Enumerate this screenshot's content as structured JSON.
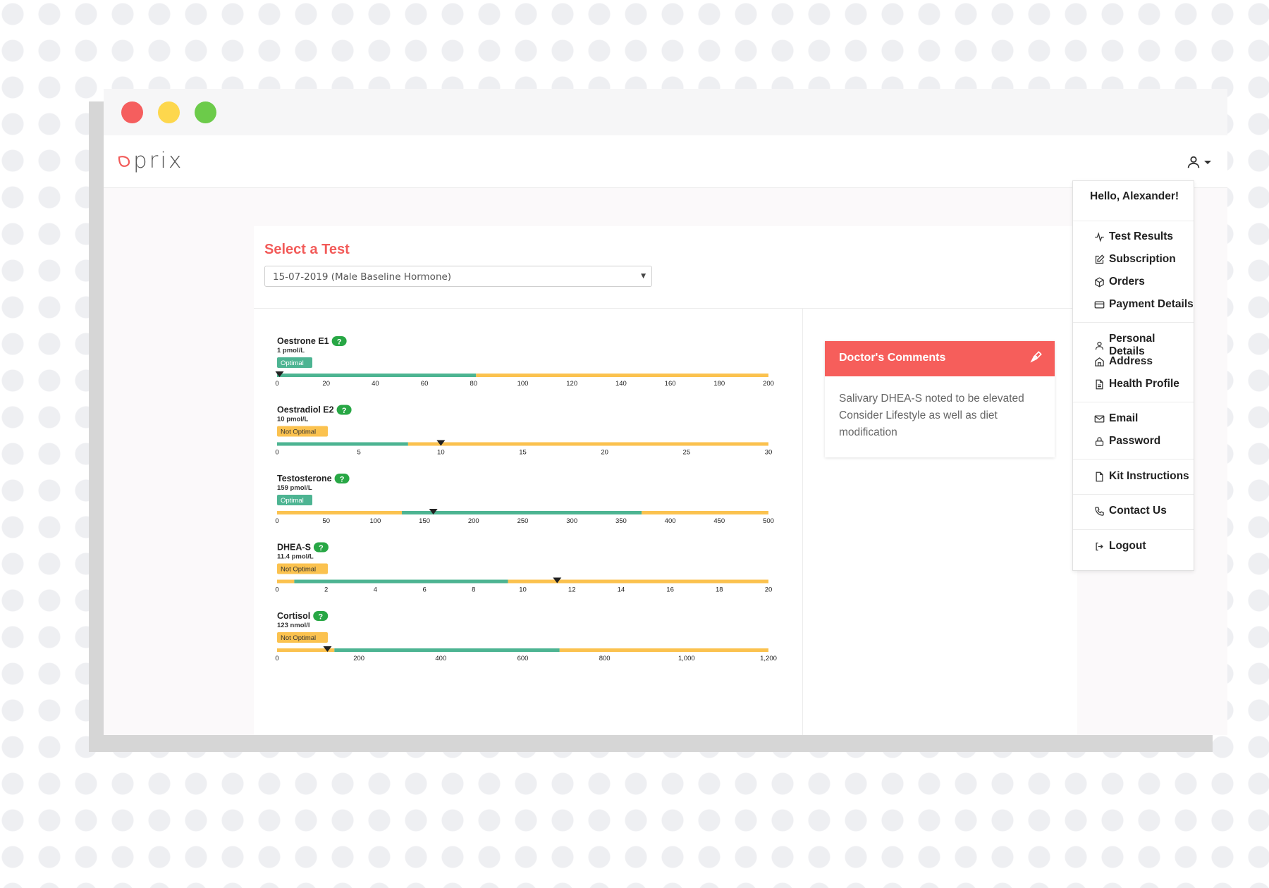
{
  "window": {
    "controls": [
      {
        "name": "close",
        "color": "#f55e5e"
      },
      {
        "name": "minimize",
        "color": "#fdd74d"
      },
      {
        "name": "maximize",
        "color": "#6ccb4a"
      }
    ]
  },
  "header": {
    "logo_text": "prix",
    "user_icon": "user-icon"
  },
  "select_test": {
    "title": "Select a Test",
    "selected": "15-07-2019 (Male Baseline Hormone)"
  },
  "doctor": {
    "title": "Doctor's Comments",
    "icon": "pen-icon",
    "lines": [
      "Salivary DHEA-S noted to be elevated",
      "Consider Lifestyle as well as diet",
      "modification"
    ]
  },
  "user_menu": {
    "greeting": "Hello, Alexander!",
    "items": [
      {
        "label": "Test Results",
        "icon": "activity-icon"
      },
      {
        "label": "Subscription",
        "icon": "edit-icon"
      },
      {
        "label": "Orders",
        "icon": "box-icon"
      },
      {
        "label": "Payment Details",
        "icon": "credit-card-icon"
      },
      {
        "label": "Personal Details",
        "icon": "user-icon"
      },
      {
        "label": "Address",
        "icon": "home-icon"
      },
      {
        "label": "Health Profile",
        "icon": "file-text-icon"
      },
      {
        "label": "Email",
        "icon": "mail-icon"
      },
      {
        "label": "Password",
        "icon": "lock-icon"
      },
      {
        "label": "Kit Instructions",
        "icon": "file-icon"
      },
      {
        "label": "Contact Us",
        "icon": "phone-icon"
      },
      {
        "label": "Logout",
        "icon": "log-out-icon"
      }
    ]
  },
  "colors": {
    "optimal": "#4db492",
    "not_optimal": "#fbc24f",
    "accent": "#f25b59",
    "help": "#28a745"
  },
  "chart_data": [
    {
      "type": "range-bar",
      "name": "Oestrone E1",
      "value_label": "1 pmol/L",
      "status": "Optimal",
      "value": 1,
      "xlim": [
        0,
        200
      ],
      "ticks": [
        0,
        20,
        40,
        60,
        80,
        100,
        120,
        140,
        160,
        180,
        200
      ],
      "tick_labels": [
        "0",
        "20",
        "40",
        "60",
        "80",
        "100",
        "120",
        "140",
        "160",
        "180",
        "200"
      ],
      "segments": [
        {
          "from": 0,
          "to": 81,
          "status": "optimal"
        },
        {
          "from": 81,
          "to": 200,
          "status": "not_optimal"
        }
      ]
    },
    {
      "type": "range-bar",
      "name": "Oestradiol E2",
      "value_label": "10 pmol/L",
      "status": "Not Optimal",
      "value": 10,
      "xlim": [
        0,
        30
      ],
      "ticks": [
        0,
        5,
        10,
        15,
        20,
        25,
        30
      ],
      "tick_labels": [
        "0",
        "5",
        "10",
        "15",
        "20",
        "25",
        "30"
      ],
      "segments": [
        {
          "from": 0,
          "to": 8,
          "status": "optimal"
        },
        {
          "from": 8,
          "to": 30,
          "status": "not_optimal"
        }
      ]
    },
    {
      "type": "range-bar",
      "name": "Testosterone",
      "value_label": "159 pmol/L",
      "status": "Optimal",
      "value": 159,
      "xlim": [
        0,
        500
      ],
      "ticks": [
        0,
        50,
        100,
        150,
        200,
        250,
        300,
        350,
        400,
        450,
        500
      ],
      "tick_labels": [
        "0",
        "50",
        "100",
        "150",
        "200",
        "250",
        "300",
        "350",
        "400",
        "450",
        "500"
      ],
      "segments": [
        {
          "from": 0,
          "to": 127,
          "status": "not_optimal"
        },
        {
          "from": 127,
          "to": 371,
          "status": "optimal"
        },
        {
          "from": 371,
          "to": 500,
          "status": "not_optimal"
        }
      ]
    },
    {
      "type": "range-bar",
      "name": "DHEA-S",
      "value_label": "11.4 pmol/L",
      "status": "Not Optimal",
      "value": 11.4,
      "xlim": [
        0,
        20
      ],
      "ticks": [
        0,
        2,
        4,
        6,
        8,
        10,
        12,
        14,
        16,
        18,
        20
      ],
      "tick_labels": [
        "0",
        "2",
        "4",
        "6",
        "8",
        "10",
        "12",
        "14",
        "16",
        "18",
        "20"
      ],
      "segments": [
        {
          "from": 0,
          "to": 0.7,
          "status": "not_optimal"
        },
        {
          "from": 0.7,
          "to": 9.4,
          "status": "optimal"
        },
        {
          "from": 9.4,
          "to": 20,
          "status": "not_optimal"
        }
      ]
    },
    {
      "type": "range-bar",
      "name": "Cortisol",
      "value_label": "123 nmol/l",
      "status": "Not Optimal",
      "value": 123,
      "xlim": [
        0,
        1200
      ],
      "ticks": [
        0,
        200,
        400,
        600,
        800,
        1000,
        1200
      ],
      "tick_labels": [
        "0",
        "200",
        "400",
        "600",
        "800",
        "1,000",
        "1,200"
      ],
      "segments": [
        {
          "from": 0,
          "to": 140,
          "status": "not_optimal"
        },
        {
          "from": 140,
          "to": 690,
          "status": "optimal"
        },
        {
          "from": 690,
          "to": 1200,
          "status": "not_optimal"
        }
      ]
    }
  ]
}
